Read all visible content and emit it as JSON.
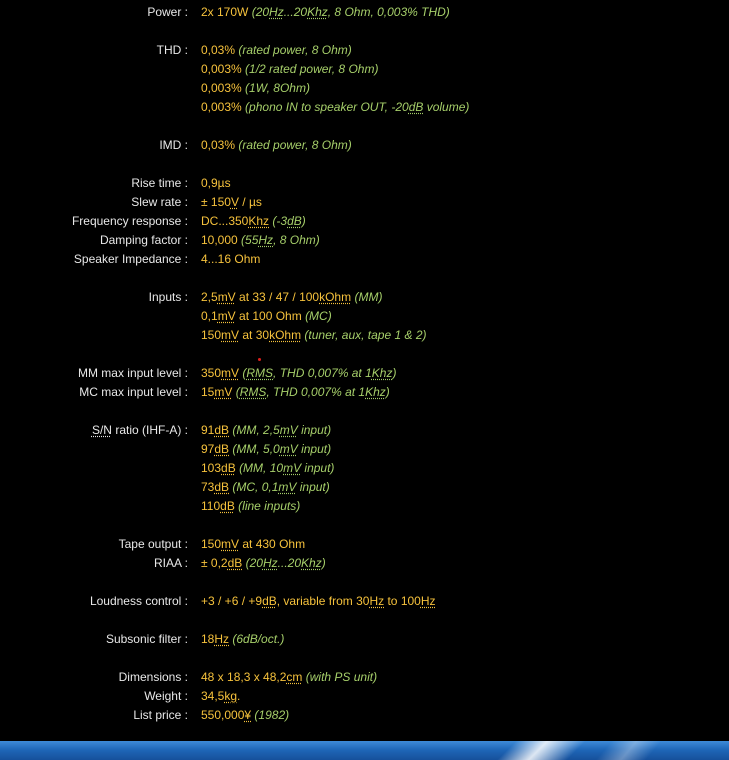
{
  "specs": [
    {
      "label": "Power :",
      "lines": [
        [
          [
            "2x 170W ",
            "v"
          ],
          [
            "(20",
            "n"
          ],
          [
            "Hz",
            "n u"
          ],
          [
            "...20",
            "n"
          ],
          [
            "Khz",
            "n u"
          ],
          [
            ", 8 Ohm, 0,003% THD)",
            "n"
          ]
        ]
      ]
    },
    {
      "gap": true
    },
    {
      "label": "THD :",
      "lines": [
        [
          [
            "0,03% ",
            "v"
          ],
          [
            "(rated power, 8 Ohm)",
            "n"
          ]
        ],
        [
          [
            "0,003% ",
            "v"
          ],
          [
            "(1/2 rated power, 8 Ohm)",
            "n"
          ]
        ],
        [
          [
            "0,003% ",
            "v"
          ],
          [
            "(1W, 8Ohm)",
            "n"
          ]
        ],
        [
          [
            "0,003% ",
            "v"
          ],
          [
            "(phono IN to speaker OUT, -20",
            "n"
          ],
          [
            "dB",
            "n u"
          ],
          [
            " volume)",
            "n"
          ]
        ]
      ]
    },
    {
      "gap": true
    },
    {
      "label": "IMD :",
      "lines": [
        [
          [
            "0,03% ",
            "v"
          ],
          [
            "(rated power, 8 Ohm)",
            "n"
          ]
        ]
      ]
    },
    {
      "gap": true
    },
    {
      "label": "Rise time :",
      "lines": [
        [
          [
            "0,9µs",
            "v"
          ]
        ]
      ]
    },
    {
      "label": "Slew rate :",
      "lines": [
        [
          [
            "± 150",
            "v"
          ],
          [
            "V",
            "v u"
          ],
          [
            " / µs",
            "v"
          ]
        ]
      ]
    },
    {
      "label": "Frequency response :",
      "lines": [
        [
          [
            "DC...350",
            "v"
          ],
          [
            "Khz",
            "v u"
          ],
          [
            " ",
            "v"
          ],
          [
            "(-3",
            "n"
          ],
          [
            "dB",
            "n u"
          ],
          [
            ")",
            "n"
          ]
        ]
      ]
    },
    {
      "label": "Damping factor :",
      "lines": [
        [
          [
            "10,000 ",
            "v"
          ],
          [
            "(55",
            "n"
          ],
          [
            "Hz",
            "n u"
          ],
          [
            ", 8 Ohm)",
            "n"
          ]
        ]
      ]
    },
    {
      "label": "Speaker Impedance :",
      "lines": [
        [
          [
            "4...16 Ohm",
            "v"
          ]
        ]
      ]
    },
    {
      "gap": true
    },
    {
      "label": "Inputs :",
      "lines": [
        [
          [
            "2,5",
            "v"
          ],
          [
            "mV",
            "v u"
          ],
          [
            " at 33 / 47 / 100",
            "v"
          ],
          [
            "kOhm",
            "v u"
          ],
          [
            " ",
            "v"
          ],
          [
            "(MM)",
            "n"
          ]
        ],
        [
          [
            "0,1",
            "v"
          ],
          [
            "mV",
            "v u"
          ],
          [
            " at 100 Ohm ",
            "v"
          ],
          [
            "(MC)",
            "n"
          ]
        ],
        [
          [
            "150",
            "v"
          ],
          [
            "mV",
            "v u"
          ],
          [
            " at 30",
            "v"
          ],
          [
            "kOhm",
            "v u"
          ],
          [
            " ",
            "v"
          ],
          [
            "(tuner, aux, tape 1 & 2)",
            "n"
          ]
        ]
      ]
    },
    {
      "gap": true
    },
    {
      "label": "MM max input level :",
      "lines": [
        [
          [
            "350",
            "v"
          ],
          [
            "mV",
            "v u"
          ],
          [
            " ",
            "v"
          ],
          [
            "(",
            "n"
          ],
          [
            "RMS",
            "n u"
          ],
          [
            ", THD 0,007% at 1",
            "n"
          ],
          [
            "Khz",
            "n u"
          ],
          [
            ")",
            "n"
          ]
        ]
      ]
    },
    {
      "label": "MC max input level :",
      "lines": [
        [
          [
            "15",
            "v"
          ],
          [
            "mV",
            "v u"
          ],
          [
            " ",
            "v"
          ],
          [
            "(",
            "n"
          ],
          [
            "RMS",
            "n u"
          ],
          [
            ", THD 0,007% at 1",
            "n"
          ],
          [
            "Khz",
            "n u"
          ],
          [
            ")",
            "n"
          ]
        ]
      ]
    },
    {
      "gap": true
    },
    {
      "label": "S/N ratio (IHF-A) :",
      "label_abbr": "S/N",
      "label_rest": " ratio (IHF-A) :",
      "lines": [
        [
          [
            "91",
            "v"
          ],
          [
            "dB",
            "v u"
          ],
          [
            " ",
            "v"
          ],
          [
            "(MM, 2,5",
            "n"
          ],
          [
            "mV",
            "n u"
          ],
          [
            " input)",
            "n"
          ]
        ],
        [
          [
            "97",
            "v"
          ],
          [
            "dB",
            "v u"
          ],
          [
            " ",
            "v"
          ],
          [
            "(MM, 5,0",
            "n"
          ],
          [
            "mV",
            "n u"
          ],
          [
            " input)",
            "n"
          ]
        ],
        [
          [
            "103",
            "v"
          ],
          [
            "dB",
            "v u"
          ],
          [
            " ",
            "v"
          ],
          [
            "(MM, 10",
            "n"
          ],
          [
            "mV",
            "n u"
          ],
          [
            " input)",
            "n"
          ]
        ],
        [
          [
            "73",
            "v"
          ],
          [
            "dB",
            "v u"
          ],
          [
            " ",
            "v"
          ],
          [
            "(MC, 0,1",
            "n"
          ],
          [
            "mV",
            "n u"
          ],
          [
            " input)",
            "n"
          ]
        ],
        [
          [
            "110",
            "v"
          ],
          [
            "dB",
            "v u"
          ],
          [
            " ",
            "v"
          ],
          [
            "(line inputs)",
            "n"
          ]
        ]
      ]
    },
    {
      "gap": true
    },
    {
      "label": "Tape output :",
      "lines": [
        [
          [
            "150",
            "v"
          ],
          [
            "mV",
            "v u"
          ],
          [
            " at 430 Ohm",
            "v"
          ]
        ]
      ]
    },
    {
      "label": "RIAA :",
      "lines": [
        [
          [
            "± 0,2",
            "v"
          ],
          [
            "dB",
            "v u"
          ],
          [
            " ",
            "v"
          ],
          [
            "(20",
            "n"
          ],
          [
            "Hz",
            "n u"
          ],
          [
            "...20",
            "n"
          ],
          [
            "Khz",
            "n u"
          ],
          [
            ")",
            "n"
          ]
        ]
      ]
    },
    {
      "gap": true
    },
    {
      "label": "Loudness control :",
      "lines": [
        [
          [
            "+3 / +6 / +9",
            "v"
          ],
          [
            "dB",
            "v u"
          ],
          [
            ", variable from 30",
            "v"
          ],
          [
            "Hz",
            "v u"
          ],
          [
            " to 100",
            "v"
          ],
          [
            "Hz",
            "v u"
          ]
        ]
      ]
    },
    {
      "gap": true
    },
    {
      "label": "Subsonic filter :",
      "lines": [
        [
          [
            "18",
            "v"
          ],
          [
            "Hz",
            "v u"
          ],
          [
            " ",
            "v"
          ],
          [
            "(6dB/oct.)",
            "n"
          ]
        ]
      ]
    },
    {
      "gap": true
    },
    {
      "label": "Dimensions :",
      "lines": [
        [
          [
            "48 x 18,3 x 48,2",
            "v"
          ],
          [
            "cm",
            "v u"
          ],
          [
            " ",
            "v"
          ],
          [
            "(with PS unit)",
            "n"
          ]
        ]
      ]
    },
    {
      "label": "Weight :",
      "lines": [
        [
          [
            "34,5",
            "v"
          ],
          [
            "kg",
            "v u"
          ],
          [
            ".",
            "v"
          ]
        ]
      ]
    },
    {
      "label": "List price :",
      "lines": [
        [
          [
            "550,000",
            "v"
          ],
          [
            "¥",
            "v u"
          ],
          [
            " ",
            "v"
          ],
          [
            "(1982)",
            "n"
          ]
        ]
      ]
    }
  ],
  "colors": {
    "background": "#000000",
    "label": "#e8e8e8",
    "value": "#f6c23c",
    "note": "#a6cf6a",
    "taskbar": "#1f67b8"
  }
}
